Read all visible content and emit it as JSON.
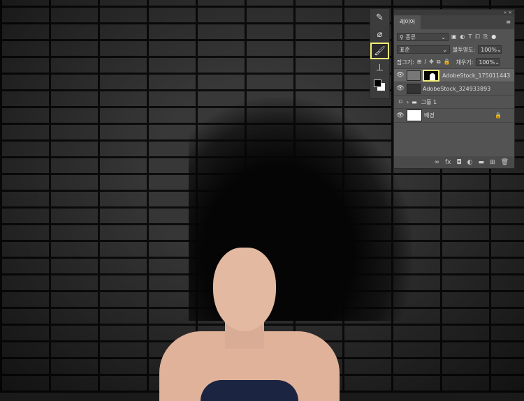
{
  "toolbar": {
    "tools": [
      {
        "icon": "eyedropper-icon"
      },
      {
        "icon": "healing-brush-icon"
      },
      {
        "icon": "brush-icon",
        "selected": true
      },
      {
        "icon": "clone-stamp-icon"
      }
    ]
  },
  "panel": {
    "tab": "레이어",
    "filter": "종류",
    "blend_mode": "표준",
    "opacity_label": "불투명도:",
    "opacity": "100%",
    "lock_label": "잠그기:",
    "fill_label": "채우기:",
    "fill": "100%",
    "layers": [
      {
        "name": "AdobeStock_175011443",
        "visible": true,
        "has_mask": true,
        "selected": true
      },
      {
        "name": "AdobeStock_324933893",
        "visible": true
      },
      {
        "name": "그룹 1",
        "visible": false,
        "group": true
      },
      {
        "name": "배경",
        "visible": true,
        "locked": true
      }
    ],
    "highlight_color": "#f3f07a"
  }
}
